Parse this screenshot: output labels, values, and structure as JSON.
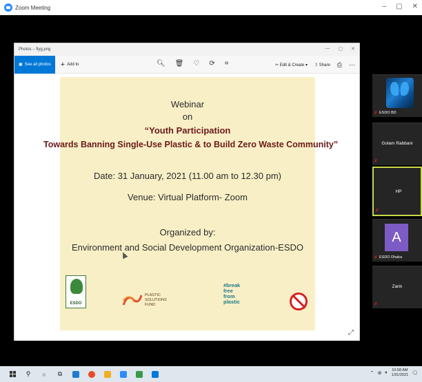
{
  "zoom": {
    "title": "Zoom Meeting",
    "controls": {
      "minimize": "–",
      "restore": "▢",
      "close": "✕"
    }
  },
  "photos": {
    "title": "Photos – flyg.png",
    "controls": {
      "minimize": "—",
      "restore": "▢",
      "close": "✕"
    },
    "toolbar": {
      "see_all": "See all photos",
      "add_to": "Add to",
      "edit_create": "Edit & Create",
      "share": "Share",
      "print_icon": "printer-icon",
      "more_icon": "more-icon"
    }
  },
  "slide": {
    "line1": "Webinar",
    "line2": "on",
    "line3": "“Youth Participation",
    "line4": "Towards Banning Single-Use Plastic & to Build Zero Waste Community”",
    "date": "Date: 31 January, 2021 (11.00 am to 12.30 pm)",
    "venue": "Venue: Virtual Platform- Zoom",
    "organized": "Organized by:",
    "org_name": "Environment and Social Development Organization-ESDO",
    "logos": {
      "esdo": "ESDO",
      "psf": [
        "PLASTIC",
        "SOLUTIONS",
        "FUND"
      ],
      "bffp": [
        "#break",
        "free",
        "from",
        "plastic"
      ]
    }
  },
  "participants": [
    {
      "name": "ESDO BD",
      "type": "image"
    },
    {
      "name": "Golam Rabbani",
      "type": "name"
    },
    {
      "name": "HP",
      "type": "name",
      "active": true
    },
    {
      "name": "ESDO Dhaka",
      "type": "avatar",
      "initial": "A"
    },
    {
      "name": "Zarin",
      "type": "name"
    }
  ],
  "taskbar": {
    "clock_time": "10:58 AM",
    "clock_date": "1/31/2021"
  },
  "colors": {
    "slide_bg": "#f8efc6",
    "title_red": "#6b1a1a",
    "active_border": "#c8d84a",
    "avatar_purple": "#7c5cc4",
    "photos_blue": "#0078d7"
  }
}
